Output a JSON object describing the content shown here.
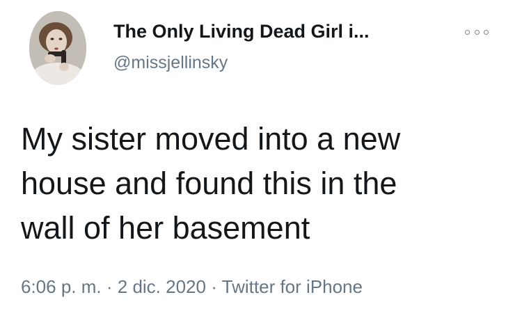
{
  "user": {
    "display_name": "The Only Living Dead Girl i...",
    "handle": "@missjellinsky",
    "avatar_alt": "avatar"
  },
  "tweet": {
    "text_lines": [
      "My sister moved into a new",
      "house and found this in the",
      "wall of her basement"
    ]
  },
  "meta": {
    "time": "6:06 p. m.",
    "separator": "·",
    "date": "2 dic. 2020",
    "source": "Twitter for iPhone"
  },
  "icons": {
    "more": "more-options-icon",
    "avatar": "profile-photo"
  },
  "colors": {
    "name": "#14171a",
    "handle": "#657786",
    "background": "#ffffff"
  }
}
